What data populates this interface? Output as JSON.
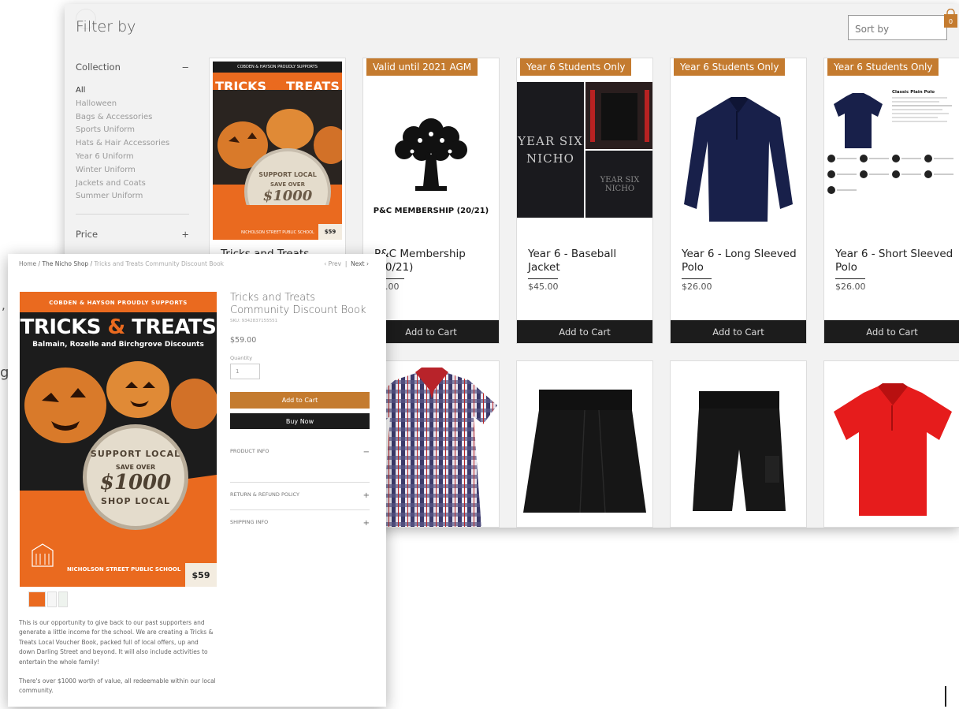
{
  "filters": {
    "title": "Filter by",
    "collection_label": "Collection",
    "collection_toggle": "−",
    "price_label": "Price",
    "price_toggle": "+",
    "items": [
      "All",
      "Halloween",
      "Bags & Accessories",
      "Sports Uniform",
      "Hats & Hair Accessories",
      "Year 6 Uniform",
      "Winter Uniform",
      "Jackets and Coats",
      "Summer Uniform"
    ]
  },
  "sort": {
    "placeholder": "Sort by"
  },
  "cart": {
    "count": "0"
  },
  "products": [
    {
      "name": "Tricks and Treats",
      "badge": "",
      "price": "",
      "button": "Add to Cart"
    },
    {
      "name": "P&C Membership (20/21)",
      "badge": "Valid until 2021 AGM",
      "price": "$5.00",
      "button": "Add to Cart",
      "image_text": "P&C MEMBERSHIP (20/21)"
    },
    {
      "name": "Year 6 - Baseball Jacket",
      "badge": "Year 6 Students Only",
      "price": "$45.00",
      "button": "Add to Cart",
      "image_text_1": "YEAR SIX",
      "image_text_2": "NICHO"
    },
    {
      "name": "Year 6 - Long Sleeved Polo",
      "badge": "Year 6 Students Only",
      "price": "$26.00",
      "button": "Add to Cart"
    },
    {
      "name": "Year 6 - Short Sleeved Polo",
      "badge": "Year 6 Students Only",
      "price": "$26.00",
      "button": "Add to Cart",
      "image_text": "Classic Plain Polo"
    }
  ],
  "cover": {
    "top": "COBDEN & HAYSON PROUDLY SUPPORTS",
    "title_a": "TRICKS",
    "amp": "&",
    "title_b": "TREATS",
    "subtitle": "Balmain, Rozelle and Birchgrove Discounts",
    "seal_top": "SUPPORT LOCAL",
    "seal_save": "SAVE OVER",
    "seal_amount": "$1000",
    "seal_bottom": "SHOP LOCAL",
    "school": "NICHOLSON STREET PUBLIC SCHOOL",
    "price_tag": "$59"
  },
  "detail": {
    "breadcrumb": {
      "home": "Home",
      "shop": "The Nicho Shop",
      "current": "Tricks and Treats Community Discount Book"
    },
    "pager": {
      "prev": "Prev",
      "next": "Next"
    },
    "title": "Tricks and Treats Community Discount Book",
    "sku": "SKU: 9342837155551",
    "price": "$59.00",
    "quantity_label": "Quantity",
    "quantity_value": "1",
    "add_to_cart": "Add to Cart",
    "buy_now": "Buy Now",
    "accordion": [
      {
        "label": "PRODUCT INFO",
        "icon": "−"
      },
      {
        "label": "RETURN & REFUND POLICY",
        "icon": "+"
      },
      {
        "label": "SHIPPING INFO",
        "icon": "+"
      }
    ],
    "description_1": "This is our opportunity to give back to our past supporters and generate a little income for the school. We are creating a Tricks & Treats Local Voucher Book, packed full of local offers, up and down Darling Street and beyond. It will also include activities to entertain the whole family!",
    "description_2": "There's over $1000 worth of value, all redeemable within our local community."
  },
  "fragments": {
    "comma": ",",
    "g": "g"
  },
  "colors": {
    "accent": "#c47b2f",
    "dark": "#1c1c1c",
    "cover_orange": "#ea6a1f"
  }
}
